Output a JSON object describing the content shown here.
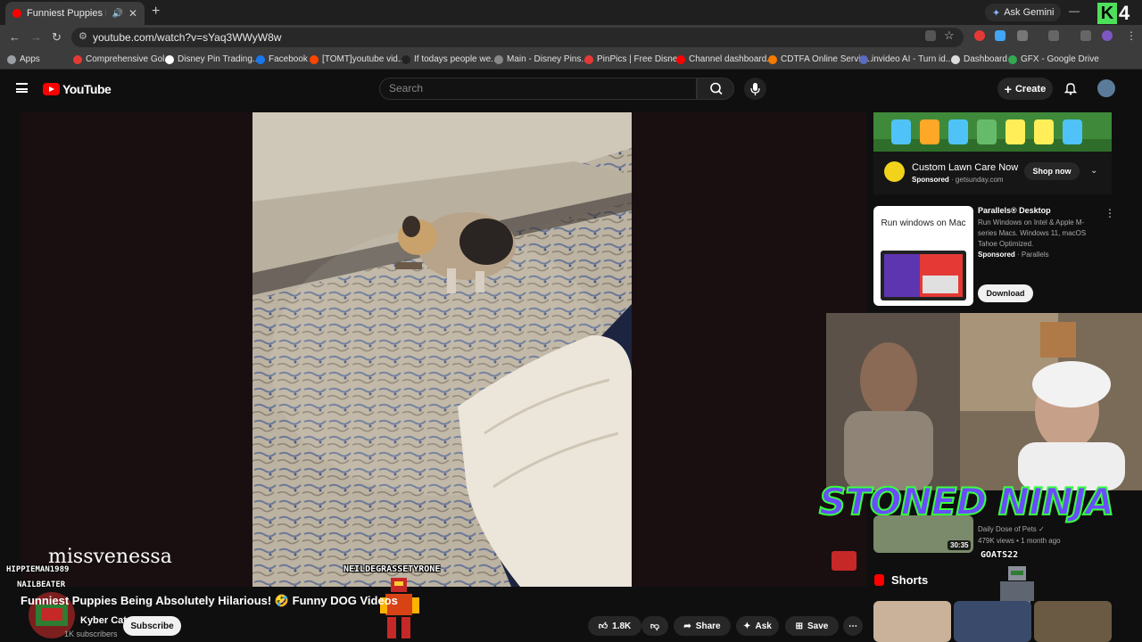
{
  "browser": {
    "tab_title": "Funniest Puppies Being Abs",
    "url": "youtube.com/watch?v=sYaq3WWyW8w",
    "gemini_label": "Ask Gemini",
    "overlay_badge": "4",
    "bookmarks": [
      {
        "label": "Apps",
        "color": "#9aa0a6"
      },
      {
        "label": "Comprehensive Gol...",
        "color": "#e53935"
      },
      {
        "label": "Disney Pin Trading...",
        "color": "#ffffff"
      },
      {
        "label": "Facebook",
        "color": "#1877f2"
      },
      {
        "label": "[TOMT]youtube vid...",
        "color": "#ff4500"
      },
      {
        "label": "If todays people we...",
        "color": "#222222"
      },
      {
        "label": "Main - Disney Pins...",
        "color": "#888888"
      },
      {
        "label": "PinPics | Free Disne...",
        "color": "#e53935"
      },
      {
        "label": "Channel dashboard...",
        "color": "#ff0000"
      },
      {
        "label": "CDTFA Online Servic...",
        "color": "#f57c00"
      },
      {
        "label": "invideo AI - Turn id...",
        "color": "#5c6bc0"
      },
      {
        "label": "Dashboard",
        "color": "#dddddd"
      },
      {
        "label": "GFX - Google Drive",
        "color": "#34a853"
      }
    ]
  },
  "youtube": {
    "logo_text": "YouTube",
    "search_placeholder": "Search",
    "create_label": "Create"
  },
  "video": {
    "title": "Funniest Puppies Being Absolutely Hilarious! 🤣 Funny DOG Videos",
    "channel": "Kyber Cat",
    "subscribers": "1K subscribers",
    "subscribe_label": "Subscribe",
    "likes": "1.8K",
    "share_label": "Share",
    "ask_label": "Ask",
    "save_label": "Save"
  },
  "overlays": {
    "streamer_name": "missvenessa",
    "watermark": "NEILDEGRASSETYRONE",
    "chat_names": [
      "HIPPIEMAN1989",
      "NAILBEATER"
    ],
    "webcam_brand": "STONED NINJA",
    "goat_tag": "GOATS22"
  },
  "sidebar": {
    "ad": {
      "title": "Custom Lawn Care Now",
      "sponsored": "Sponsored",
      "domain": "getsunday.com",
      "cta": "Shop now"
    },
    "parallels": {
      "title": "Parallels® Desktop",
      "description": "Run Windows on Intel & Apple M-series Macs. Windows 11, macOS Tahoe Optimized.",
      "sponsored": "Sponsored",
      "advertiser": "Parallels",
      "thumb_text": "Run windows on Mac",
      "cta": "Download"
    },
    "recommended": {
      "channel": "Daily Dose of Pets",
      "meta": "479K views • 1 month ago",
      "duration": "30:35"
    },
    "shorts_label": "Shorts"
  }
}
